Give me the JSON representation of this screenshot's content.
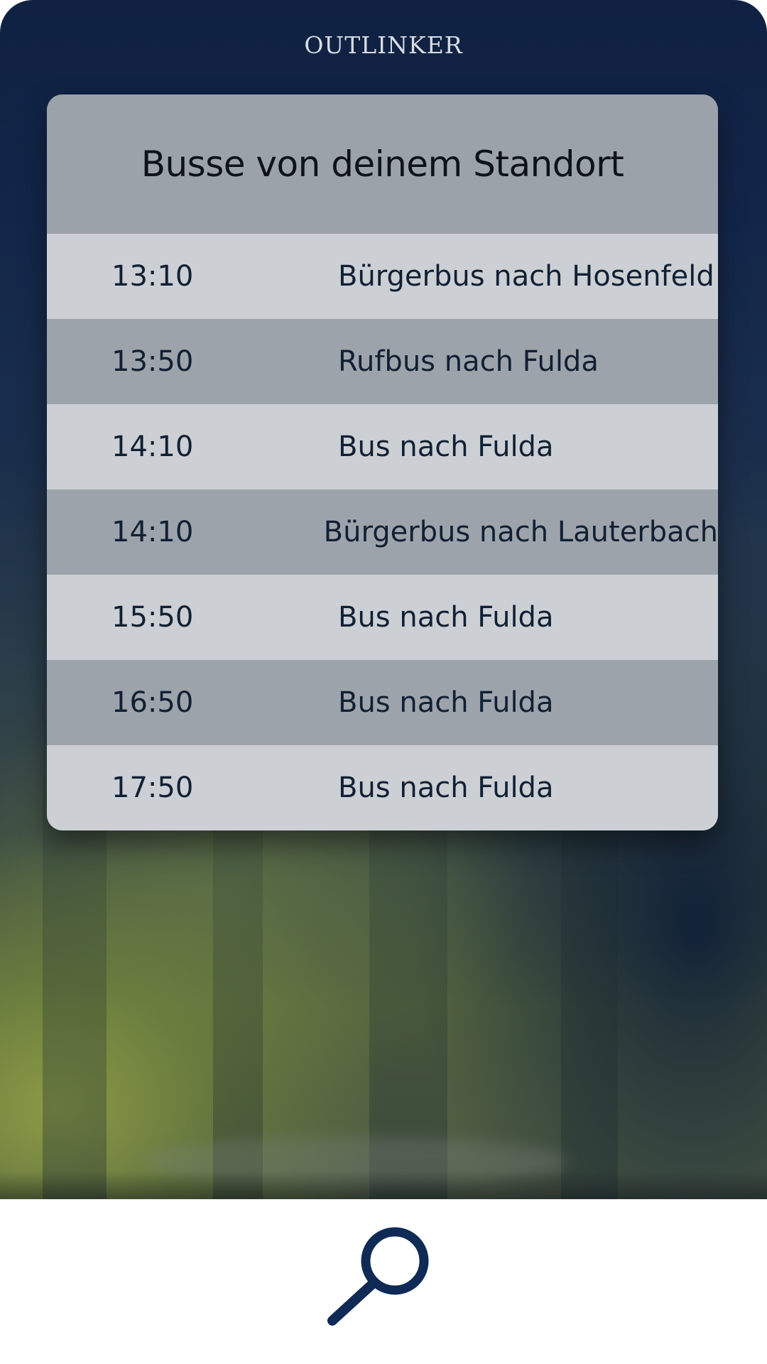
{
  "app": {
    "title": "OUTLINKER"
  },
  "schedule": {
    "title": "Busse von deinem Standort",
    "departures": [
      {
        "time": "13:10",
        "destination": "Bürgerbus nach Hosenfeld"
      },
      {
        "time": "13:50",
        "destination": "Rufbus nach Fulda"
      },
      {
        "time": "14:10",
        "destination": "Bus nach Fulda"
      },
      {
        "time": "14:10",
        "destination": "Bürgerbus nach Lauterbach"
      },
      {
        "time": "15:50",
        "destination": "Bus nach Fulda"
      },
      {
        "time": "16:50",
        "destination": "Bus nach Fulda"
      },
      {
        "time": "17:50",
        "destination": "Bus nach Fulda"
      }
    ]
  },
  "bottom_nav": {
    "search_icon": "search-icon"
  },
  "colors": {
    "icon": "#0f2a55",
    "row_light": "#ccd0d4",
    "row_dark": "#9da3aa",
    "text": "#112034"
  }
}
